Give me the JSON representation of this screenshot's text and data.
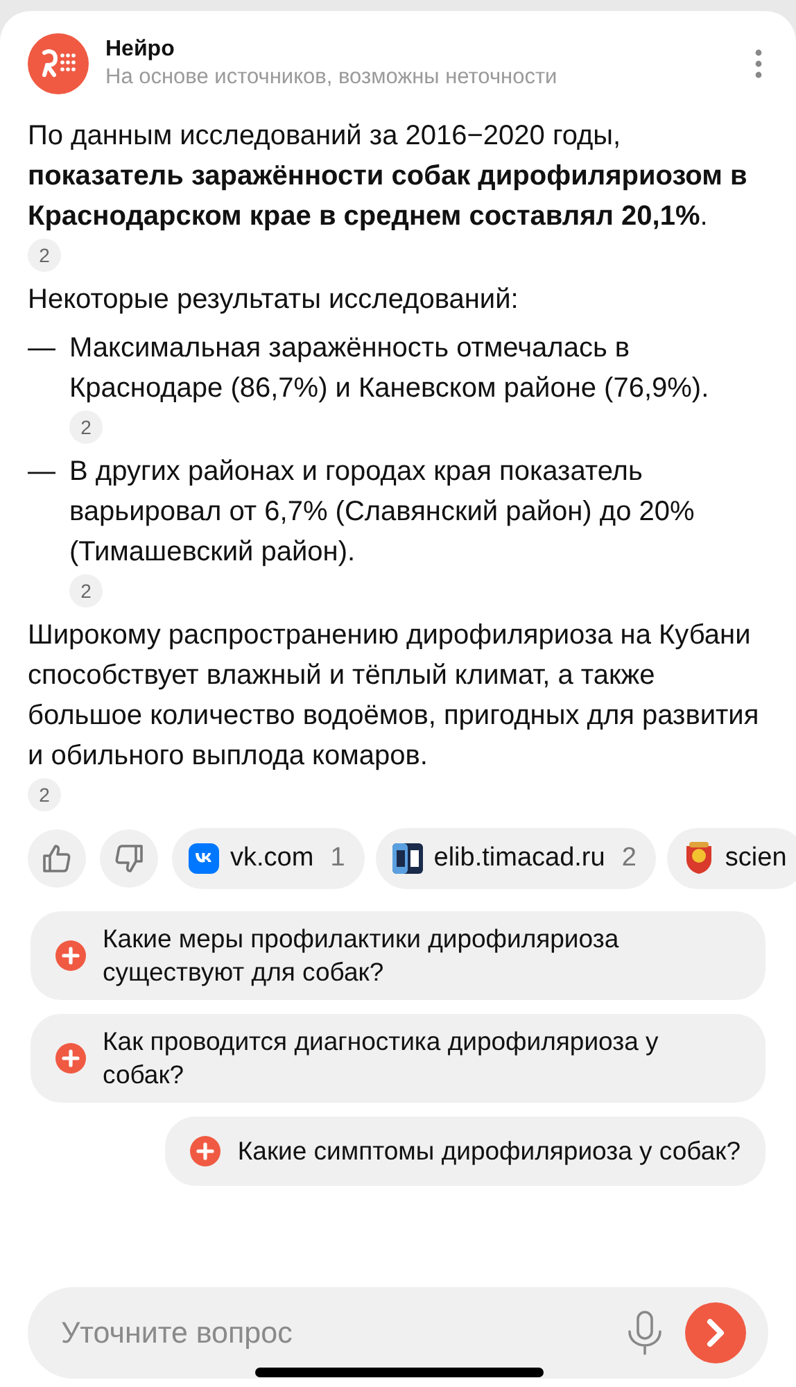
{
  "header": {
    "title": "Нейро",
    "subtitle": "На основе источников, возможны неточности"
  },
  "answer": [
    {
      "kind": "paragraph",
      "text": "По данным исследований за 2016−2020 годы, **показатель заражённости собак дирофиляриозом в Краснодарском крае в среднем составлял 20,1%**.",
      "citation": "2"
    },
    {
      "kind": "paragraph",
      "text": "Некоторые результаты исследований:"
    },
    {
      "kind": "bullet",
      "marker": "—",
      "text": "Максимальная заражённость отмечалась в Краснодаре (86,7%) и Каневском районе (76,9%).",
      "citation": "2"
    },
    {
      "kind": "bullet",
      "marker": "—",
      "text": "В других районах и городах края показатель варьировал от 6,7% (Славянский район) до 20% (Тимашевский район).",
      "citation": "2"
    },
    {
      "kind": "paragraph",
      "text": "Широкому распространению дирофиляриоза на Кубани способствует влажный и тёплый климат, а также большое количество водоёмов, пригодных для развития и обильного выплода комаров.",
      "citation": "2"
    }
  ],
  "sources": [
    {
      "kind": "vk",
      "name": "vk.com",
      "count": "1"
    },
    {
      "kind": "elib",
      "name": "elib.timacad.ru",
      "count": "2"
    },
    {
      "kind": "emblem",
      "name": "scien"
    }
  ],
  "suggestions": [
    {
      "text": "Какие меры профилактики дирофиляриоза существуют для собак?"
    },
    {
      "text": "Как проводится диагностика дирофиляриоза у собак?"
    },
    {
      "text": "Какие симптомы дирофиляриоза у собак?"
    }
  ],
  "input": {
    "placeholder": "Уточните вопрос"
  }
}
